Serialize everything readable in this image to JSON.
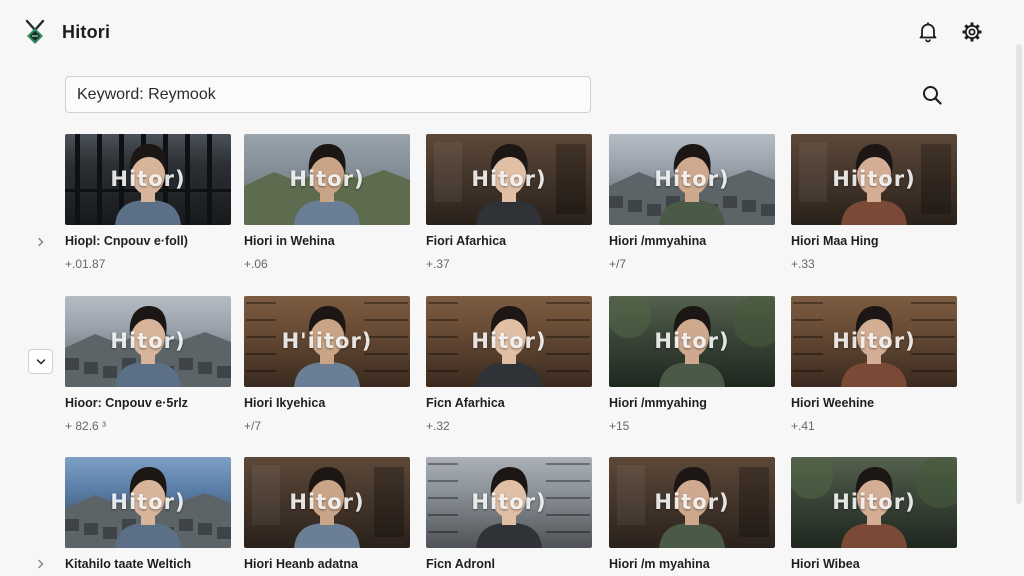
{
  "app": {
    "title": "Hitori",
    "colors": {
      "logo_green": "#2f8a5c",
      "logo_dark": "#1f2a28",
      "background": "#f7f7f8"
    }
  },
  "header": {
    "icons": [
      "bell-icon",
      "gear-icon"
    ]
  },
  "search": {
    "value": "Keyword: Reymook",
    "icon": "search-icon"
  },
  "gallery": {
    "watermark_text": [
      "Hitor)",
      "Hitor)",
      "Hitor)",
      "Hitor)",
      "Hiitor)",
      "Hitor)",
      "H'iitor)",
      "Hitor)",
      "Hitor)",
      "Hiitor)",
      "Hitor)",
      "Hitor)",
      "Hitor)",
      "Hitor)",
      "Hiitor)"
    ],
    "rows": [
      {
        "toggle_icon": "chevron-right-icon",
        "cards": [
          {
            "title": "Hiopl: Cnpouv e·foll)",
            "meta": "+.01.87",
            "watermark": "Hitor)",
            "scene": "window"
          },
          {
            "title": "Hiori in Wehina",
            "meta": "+.06",
            "watermark": "Hitor)",
            "scene": "field"
          },
          {
            "title": "Fiori Afarhica",
            "meta": "+.37",
            "watermark": "Hitor)",
            "scene": "indoor"
          },
          {
            "title": "Hiori /mmyahina",
            "meta": "+/7",
            "watermark": "Hitor)",
            "scene": "town"
          },
          {
            "title": "Hiori Maa Hing",
            "meta": "+.33",
            "watermark": "Hiitor)",
            "scene": "indoor"
          }
        ]
      },
      {
        "toggle_icon": "chevron-down-icon",
        "cards": [
          {
            "title": "Hioor: Cnpouv e·5rlz",
            "meta": "+ 82.6 ³",
            "watermark": "Hitor)",
            "scene": "town"
          },
          {
            "title": "Hiori Ikyehica",
            "meta": "+/7",
            "watermark": "H'iitor)",
            "scene": "library"
          },
          {
            "title": "Ficn Afarhica",
            "meta": "+.32",
            "watermark": "Hitor)",
            "scene": "library"
          },
          {
            "title": "Hiori /mmyahing",
            "meta": "+15",
            "watermark": "Hitor)",
            "scene": "forest"
          },
          {
            "title": "Hiori Weehine",
            "meta": "+.41",
            "watermark": "Hiitor)",
            "scene": "library"
          }
        ]
      },
      {
        "toggle_icon": "chevron-right-icon",
        "cards": [
          {
            "title": "Kitahilo taate Weltich",
            "meta": "",
            "watermark": "Hitor)",
            "scene": "sky"
          },
          {
            "title": "Hiori Heanb adatna",
            "meta": "",
            "watermark": "Hitor)",
            "scene": "indoor"
          },
          {
            "title": "Ficn Adronl",
            "meta": "",
            "watermark": "Hitor)",
            "scene": "street"
          },
          {
            "title": "Hiori /m myahina",
            "meta": "",
            "watermark": "Hitor)",
            "scene": "indoor"
          },
          {
            "title": "Hiori Wibea",
            "meta": "",
            "watermark": "Hiitor)",
            "scene": "forest"
          }
        ]
      }
    ]
  }
}
